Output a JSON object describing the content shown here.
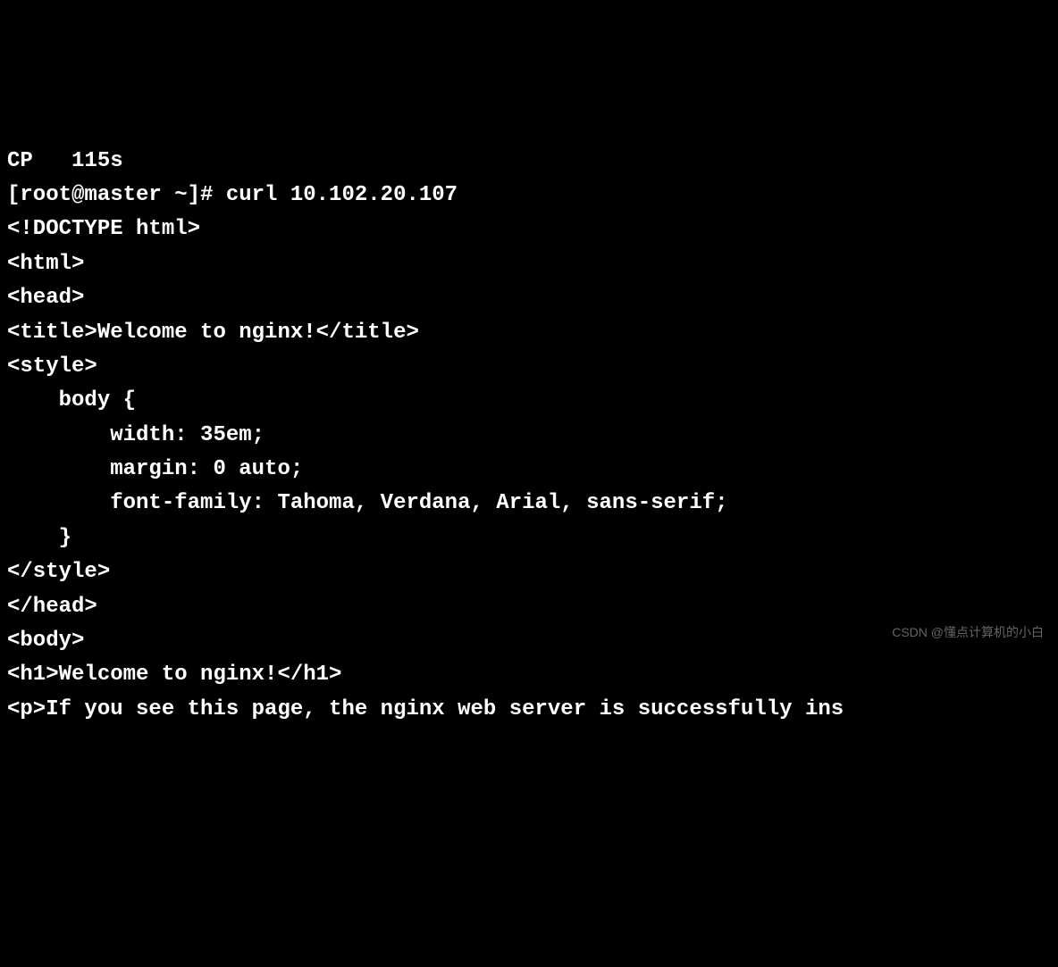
{
  "terminal": {
    "lines": [
      "CP   115s",
      "[root@master ~]# curl 10.102.20.107",
      "<!DOCTYPE html>",
      "<html>",
      "<head>",
      "<title>Welcome to nginx!</title>",
      "<style>",
      "    body {",
      "        width: 35em;",
      "        margin: 0 auto;",
      "        font-family: Tahoma, Verdana, Arial, sans-serif;",
      "    }",
      "</style>",
      "</head>",
      "<body>",
      "<h1>Welcome to nginx!</h1>",
      "<p>If you see this page, the nginx web server is successfully ins"
    ]
  },
  "watermark": "CSDN @懂点计算机的小白"
}
